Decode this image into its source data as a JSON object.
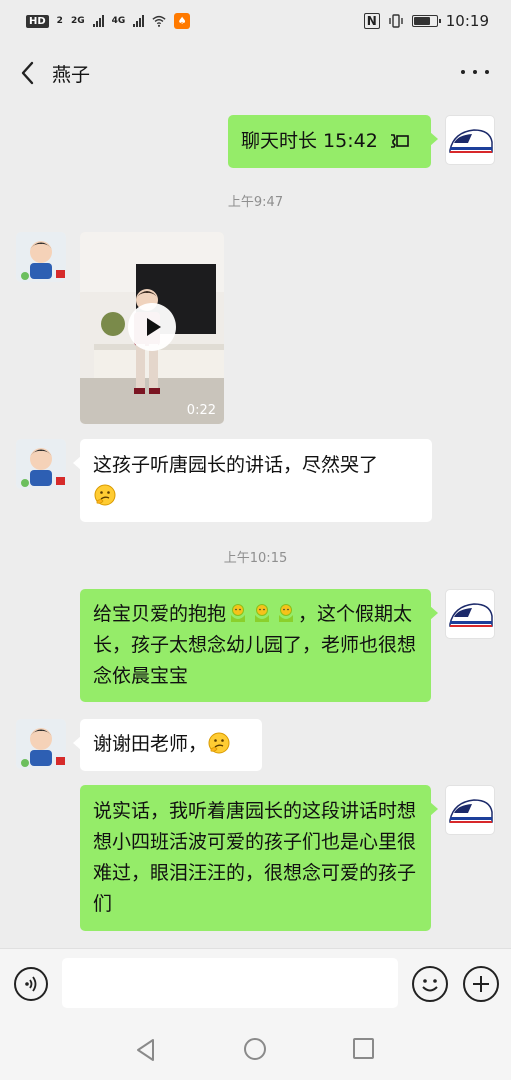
{
  "status_bar": {
    "hd_label": "HD",
    "hd_sub": "2",
    "net1": "2G",
    "net2": "4G",
    "app_badge": "♠",
    "nfc": "N",
    "battery_level": 0.8,
    "time": "10:19"
  },
  "header": {
    "title": "燕子"
  },
  "messages": [
    {
      "sender": "me",
      "text": "聊天时长 15:42",
      "type": "call"
    },
    {
      "type": "timestamp",
      "text": "上午9:47"
    },
    {
      "sender": "them",
      "type": "video",
      "duration": "0:22"
    },
    {
      "sender": "them",
      "text": "这孩子听唐园长的讲话，尽然哭了"
    },
    {
      "type": "timestamp",
      "text": "上午10:15"
    },
    {
      "sender": "me",
      "text_part1": "给宝贝爱的抱抱",
      "text_part2": "，这个假期太长，孩子太想念幼儿园了，老师也很想念依晨宝宝"
    },
    {
      "sender": "them",
      "text": "谢谢田老师，"
    },
    {
      "sender": "me",
      "text": "说实话，我听着唐园长的这段讲话时想想小四班活波可爱的孩子们也是心里很难过，眼泪汪汪的，很想念可爱的孩子们"
    }
  ],
  "colors": {
    "background": "#ededed",
    "my_bubble": "#95ec69",
    "their_bubble": "#ffffff"
  },
  "icons": {
    "back": "chevron-left-icon",
    "more": "more-dots-icon",
    "call": "phone-handset-icon",
    "hug": "hug-emoji-icon",
    "think": "thinking-emoji-icon",
    "voice": "voice-input-icon",
    "emoji": "emoji-face-icon",
    "plus": "plus-icon"
  }
}
